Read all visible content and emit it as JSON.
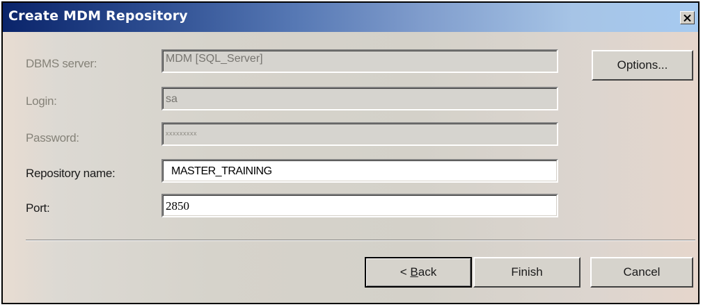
{
  "window": {
    "title": "Create MDM Repository",
    "close_glyph": "×"
  },
  "form": {
    "dbms_server": {
      "label": "DBMS server:",
      "value": "MDM [SQL_Server]",
      "enabled": false
    },
    "login": {
      "label": "Login:",
      "value": "sa",
      "enabled": false
    },
    "password": {
      "label": "Password:",
      "value": "xxxxxxxxx",
      "enabled": false
    },
    "repository_name": {
      "label": "Repository name:",
      "value": "MASTER_TRAINING",
      "enabled": true
    },
    "port": {
      "label": "Port:",
      "value": "2850",
      "enabled": true
    }
  },
  "buttons": {
    "options": "Options...",
    "back_prefix": "< ",
    "back_mnemonic": "B",
    "back_rest": "ack",
    "finish": "Finish",
    "cancel": "Cancel"
  },
  "icons": {
    "close": "close-icon"
  }
}
